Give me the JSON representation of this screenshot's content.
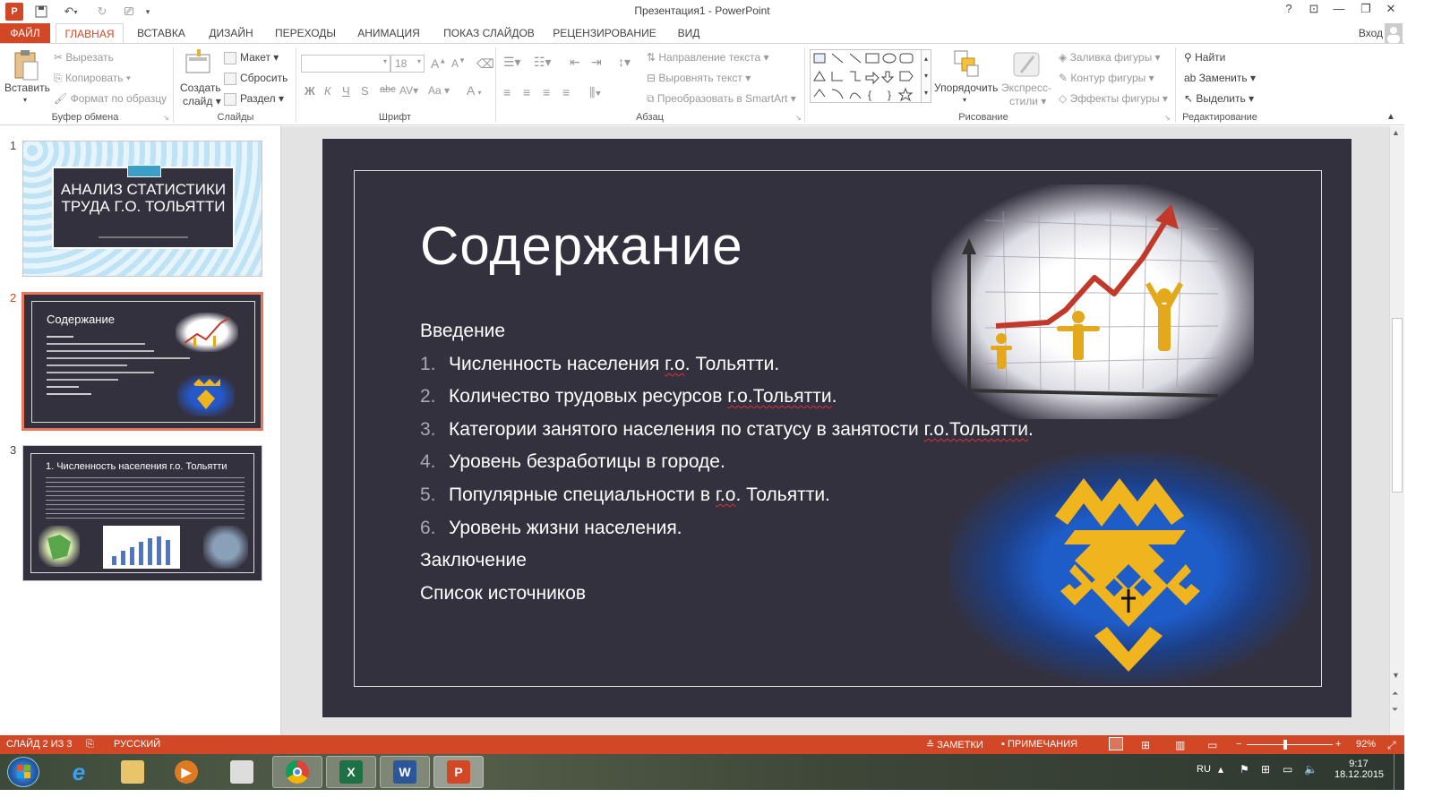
{
  "window": {
    "title": "Презентация1 - PowerPoint",
    "signin": "Вход"
  },
  "tabs": [
    "ФАЙЛ",
    "ГЛАВНАЯ",
    "ВСТАВКА",
    "ДИЗАЙН",
    "ПЕРЕХОДЫ",
    "АНИМАЦИЯ",
    "ПОКАЗ СЛАЙДОВ",
    "РЕЦЕНЗИРОВАНИЕ",
    "ВИД"
  ],
  "ribbon": {
    "clipboard": {
      "label": "Буфер обмена",
      "paste": "Вставить",
      "cut": "Вырезать",
      "copy": "Копировать",
      "format_painter": "Формат по образцу"
    },
    "slides": {
      "label": "Слайды",
      "new_slide_1": "Создать",
      "new_slide_2": "слайд",
      "layout": "Макет",
      "reset": "Сбросить",
      "section": "Раздел"
    },
    "font": {
      "label": "Шрифт",
      "size": "18"
    },
    "paragraph": {
      "label": "Абзац",
      "text_direction": "Направление текста",
      "align_text": "Выровнять текст",
      "smartart": "Преобразовать в SmartArt"
    },
    "drawing": {
      "label": "Рисование",
      "arrange": "Упорядочить",
      "quick_styles_1": "Экспресс-",
      "quick_styles_2": "стили",
      "fill": "Заливка фигуры",
      "outline": "Контур фигуры",
      "effects": "Эффекты фигуры"
    },
    "editing": {
      "label": "Редактирование",
      "find": "Найти",
      "replace": "Заменить",
      "select": "Выделить"
    }
  },
  "thumbs": {
    "t1_title": "АНАЛИЗ СТАТИСТИКИ ТРУДА Г.О. ТОЛЬЯТТИ",
    "t2_title": "Содержание",
    "t3_title": "1. Численность населения г.о. Тольятти"
  },
  "slide": {
    "title": "Содержание",
    "intro": "Введение",
    "items": [
      {
        "num": "1.",
        "pre": "Численность населения ",
        "u": "г.о",
        "post": ". Тольятти."
      },
      {
        "num": "2.",
        "pre": "Количество трудовых ресурсов ",
        "u": "г.о.Тольятти",
        "post": "."
      },
      {
        "num": "3.",
        "pre": "Категории занятого населения по статусу в занятости ",
        "u": "г.о.Тольятти",
        "post": "."
      },
      {
        "num": "4.",
        "pre": "Уровень безработицы в городе.",
        "u": "",
        "post": ""
      },
      {
        "num": "5.",
        "pre": "Популярные специальности в ",
        "u": "г.о",
        "post": ". Тольятти."
      },
      {
        "num": "6.",
        "pre": "Уровень жизни населения.",
        "u": "",
        "post": ""
      }
    ],
    "conclusion": "Заключение",
    "sources": "Список источников"
  },
  "status": {
    "slide": "СЛАЙД 2 ИЗ 3",
    "lang": "РУССКИЙ",
    "notes": "ЗАМЕТКИ",
    "comments": "ПРИМЕЧАНИЯ",
    "zoom": "92%"
  },
  "tray": {
    "lang": "RU",
    "time": "9:17",
    "date": "18.12.2015"
  },
  "colors": {
    "accent": "#d24726",
    "slide_bg": "#34313f"
  }
}
